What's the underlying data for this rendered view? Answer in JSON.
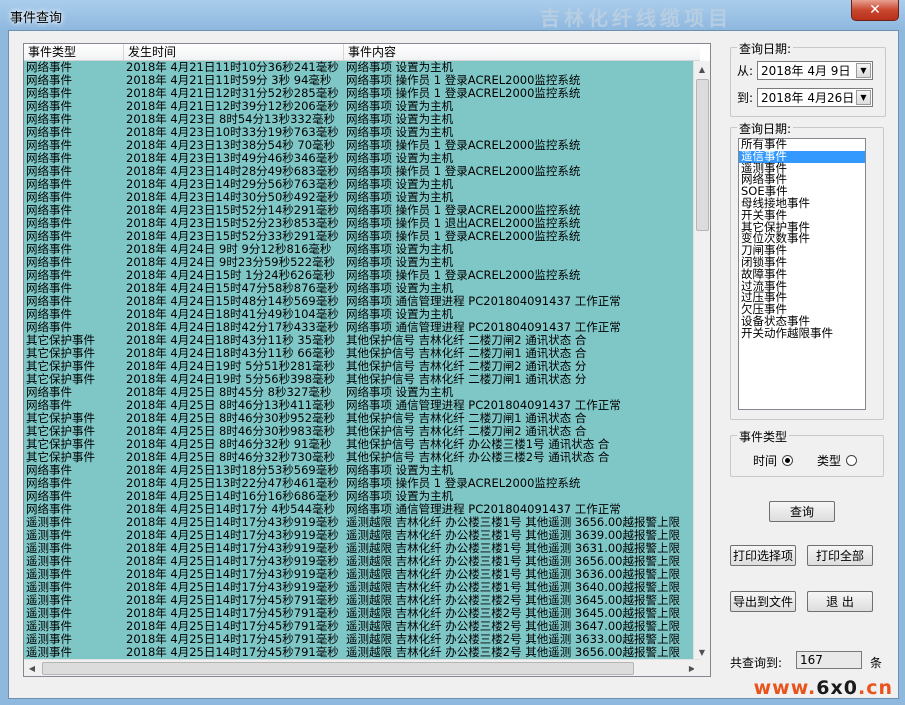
{
  "window": {
    "title": "事件查询",
    "close_glyph": "✕",
    "faint_text": "吉林化纤线缆项目"
  },
  "list": {
    "columns": [
      "事件类型",
      "发生时间",
      "事件内容"
    ],
    "rows": [
      [
        "网络事件",
        "2018年 4月21日11时10分36秒241毫秒",
        "网络事项 设置为主机"
      ],
      [
        "网络事件",
        "2018年 4月21日11时59分 3秒 94毫秒",
        "网络事项 操作员 1 登录ACREL2000监控系统"
      ],
      [
        "网络事件",
        "2018年 4月21日12时31分52秒285毫秒",
        "网络事项 操作员 1 登录ACREL2000监控系统"
      ],
      [
        "网络事件",
        "2018年 4月21日12时39分12秒206毫秒",
        "网络事项 设置为主机"
      ],
      [
        "网络事件",
        "2018年 4月23日 8时54分13秒332毫秒",
        "网络事项 设置为主机"
      ],
      [
        "网络事件",
        "2018年 4月23日10时33分19秒763毫秒",
        "网络事项 设置为主机"
      ],
      [
        "网络事件",
        "2018年 4月23日13时38分54秒 70毫秒",
        "网络事项 操作员 1 登录ACREL2000监控系统"
      ],
      [
        "网络事件",
        "2018年 4月23日13时49分46秒346毫秒",
        "网络事项 设置为主机"
      ],
      [
        "网络事件",
        "2018年 4月23日14时28分49秒683毫秒",
        "网络事项 操作员 1 登录ACREL2000监控系统"
      ],
      [
        "网络事件",
        "2018年 4月23日14时29分56秒763毫秒",
        "网络事项 设置为主机"
      ],
      [
        "网络事件",
        "2018年 4月23日14时30分50秒492毫秒",
        "网络事项 设置为主机"
      ],
      [
        "网络事件",
        "2018年 4月23日15时52分14秒291毫秒",
        "网络事项 操作员 1 登录ACREL2000监控系统"
      ],
      [
        "网络事件",
        "2018年 4月23日15时52分23秒853毫秒",
        "网络事项 操作员 1 退出ACREL2000监控系统"
      ],
      [
        "网络事件",
        "2018年 4月23日15时52分33秒291毫秒",
        "网络事项 操作员 1 登录ACREL2000监控系统"
      ],
      [
        "网络事件",
        "2018年 4月24日 9时 9分12秒816毫秒",
        "网络事项 设置为主机"
      ],
      [
        "网络事件",
        "2018年 4月24日 9时23分59秒522毫秒",
        "网络事项 设置为主机"
      ],
      [
        "网络事件",
        "2018年 4月24日15时 1分24秒626毫秒",
        "网络事项 操作员 1 登录ACREL2000监控系统"
      ],
      [
        "网络事件",
        "2018年 4月24日15时47分58秒876毫秒",
        "网络事项 设置为主机"
      ],
      [
        "网络事件",
        "2018年 4月24日15时48分14秒569毫秒",
        "网络事项 通信管理进程 PC201804091437 工作正常"
      ],
      [
        "网络事件",
        "2018年 4月24日18时41分49秒104毫秒",
        "网络事项 设置为主机"
      ],
      [
        "网络事件",
        "2018年 4月24日18时42分17秒433毫秒",
        "网络事项 通信管理进程 PC201804091437 工作正常"
      ],
      [
        "其它保护事件",
        "2018年 4月24日18时43分11秒 35毫秒",
        "其他保护信号 吉林化纤 二楼刀闸2 通讯状态  合"
      ],
      [
        "其它保护事件",
        "2018年 4月24日18时43分11秒 66毫秒",
        "其他保护信号 吉林化纤 二楼刀闸1 通讯状态  合"
      ],
      [
        "其它保护事件",
        "2018年 4月24日19时 5分51秒281毫秒",
        "其他保护信号 吉林化纤 二楼刀闸2 通讯状态  分"
      ],
      [
        "其它保护事件",
        "2018年 4月24日19时 5分56秒398毫秒",
        "其他保护信号 吉林化纤 二楼刀闸1 通讯状态  分"
      ],
      [
        "网络事件",
        "2018年 4月25日 8时45分 8秒327毫秒",
        "网络事项 设置为主机"
      ],
      [
        "网络事件",
        "2018年 4月25日 8时46分13秒411毫秒",
        "网络事项 通信管理进程 PC201804091437 工作正常"
      ],
      [
        "其它保护事件",
        "2018年 4月25日 8时46分30秒952毫秒",
        "其他保护信号 吉林化纤 二楼刀闸1 通讯状态  合"
      ],
      [
        "其它保护事件",
        "2018年 4月25日 8时46分30秒983毫秒",
        "其他保护信号 吉林化纤 二楼刀闸2 通讯状态  合"
      ],
      [
        "其它保护事件",
        "2018年 4月25日 8时46分32秒 91毫秒",
        "其他保护信号 吉林化纤 办公楼三楼1号 通讯状态  合"
      ],
      [
        "其它保护事件",
        "2018年 4月25日 8时46分32秒730毫秒",
        "其他保护信号 吉林化纤 办公楼三楼2号 通讯状态  合"
      ],
      [
        "网络事件",
        "2018年 4月25日13时18分53秒569毫秒",
        "网络事项 设置为主机"
      ],
      [
        "网络事件",
        "2018年 4月25日13时22分47秒461毫秒",
        "网络事项 操作员 1 登录ACREL2000监控系统"
      ],
      [
        "网络事件",
        "2018年 4月25日14时16分16秒686毫秒",
        "网络事项 设置为主机"
      ],
      [
        "网络事件",
        "2018年 4月25日14时17分 4秒544毫秒",
        "网络事项 通信管理进程 PC201804091437 工作正常"
      ],
      [
        "遥测事件",
        "2018年 4月25日14时17分43秒919毫秒",
        "遥测越限 吉林化纤 办公楼三楼1号 其他遥测 3656.00越报警上限"
      ],
      [
        "遥测事件",
        "2018年 4月25日14时17分43秒919毫秒",
        "遥测越限 吉林化纤 办公楼三楼1号 其他遥测 3639.00越报警上限"
      ],
      [
        "遥测事件",
        "2018年 4月25日14时17分43秒919毫秒",
        "遥测越限 吉林化纤 办公楼三楼1号 其他遥测 3631.00越报警上限"
      ],
      [
        "遥测事件",
        "2018年 4月25日14时17分43秒919毫秒",
        "遥测越限 吉林化纤 办公楼三楼1号 其他遥测 3656.00越报警上限"
      ],
      [
        "遥测事件",
        "2018年 4月25日14时17分43秒919毫秒",
        "遥测越限 吉林化纤 办公楼三楼1号 其他遥测 3636.00越报警上限"
      ],
      [
        "遥测事件",
        "2018年 4月25日14时17分43秒919毫秒",
        "遥测越限 吉林化纤 办公楼三楼1号 其他遥测 3640.00越报警上限"
      ],
      [
        "遥测事件",
        "2018年 4月25日14时17分45秒791毫秒",
        "遥测越限 吉林化纤 办公楼三楼2号 其他遥测 3645.00越报警上限"
      ],
      [
        "遥测事件",
        "2018年 4月25日14时17分45秒791毫秒",
        "遥测越限 吉林化纤 办公楼三楼2号 其他遥测 3645.00越报警上限"
      ],
      [
        "遥测事件",
        "2018年 4月25日14时17分45秒791毫秒",
        "遥测越限 吉林化纤 办公楼三楼2号 其他遥测 3647.00越报警上限"
      ],
      [
        "遥测事件",
        "2018年 4月25日14时17分45秒791毫秒",
        "遥测越限 吉林化纤 办公楼三楼2号 其他遥测 3633.00越报警上限"
      ],
      [
        "遥测事件",
        "2018年 4月25日14时17分45秒791毫秒",
        "遥测越限 吉林化纤 办公楼三楼2号 其他遥测 3656.00越报警上限"
      ]
    ]
  },
  "date_group": {
    "label": "查询日期:",
    "from_label": "从:",
    "from_value": "2018年 4月 9日",
    "to_label": "到:",
    "to_value": "2018年 4月26日"
  },
  "event_filter": {
    "label": "查询日期:",
    "items": [
      "所有事件",
      "遥信事件",
      "遥测事件",
      "网络事件",
      "SOE事件",
      "母线接地事件",
      "开关事件",
      "其它保护事件",
      "变位次数事件",
      "刀闸事件",
      "闭锁事件",
      "故障事件",
      "过流事件",
      "过压事件",
      "欠压事件",
      "设备状态事件",
      "开关动作越限事件"
    ],
    "selected_index": 1
  },
  "sort_group": {
    "label": "事件类型",
    "option_time": "时间",
    "option_type": "类型",
    "selected": "time"
  },
  "buttons": {
    "query": "查询",
    "print_selected": "打印选择项",
    "print_all": "打印全部",
    "export": "导出到文件",
    "exit": "退 出"
  },
  "summary": {
    "label": "共查询到:",
    "count": "167",
    "unit": "条"
  },
  "watermark": {
    "p1": "www.",
    "p2": "6x0",
    "p3": ".cn",
    "c1": "#e8541c",
    "c2": "#1a1a1a"
  },
  "colors": {
    "row_bg": "#7fc7c7",
    "selection": "#3399ff"
  }
}
